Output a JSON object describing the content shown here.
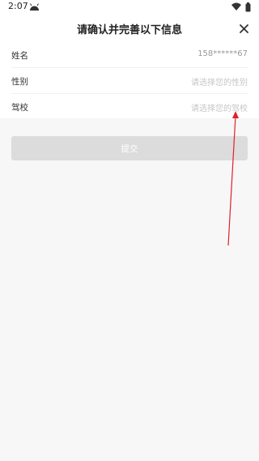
{
  "status_bar": {
    "time": "2:07"
  },
  "header": {
    "title": "请确认并完善以下信息"
  },
  "form": {
    "rows": [
      {
        "label": "姓名",
        "value": "158******67"
      },
      {
        "label": "性别",
        "placeholder": "请选择您的性别"
      },
      {
        "label": "驾校",
        "placeholder": "请选择您的驾校"
      }
    ]
  },
  "submit": {
    "label": "提交"
  },
  "colors": {
    "annotation_arrow": "#e0202a",
    "button_disabled": "#dcdcdc"
  },
  "icons": {
    "close": "close-icon",
    "wifi": "wifi-icon",
    "battery": "battery-icon",
    "app": "android-icon"
  }
}
